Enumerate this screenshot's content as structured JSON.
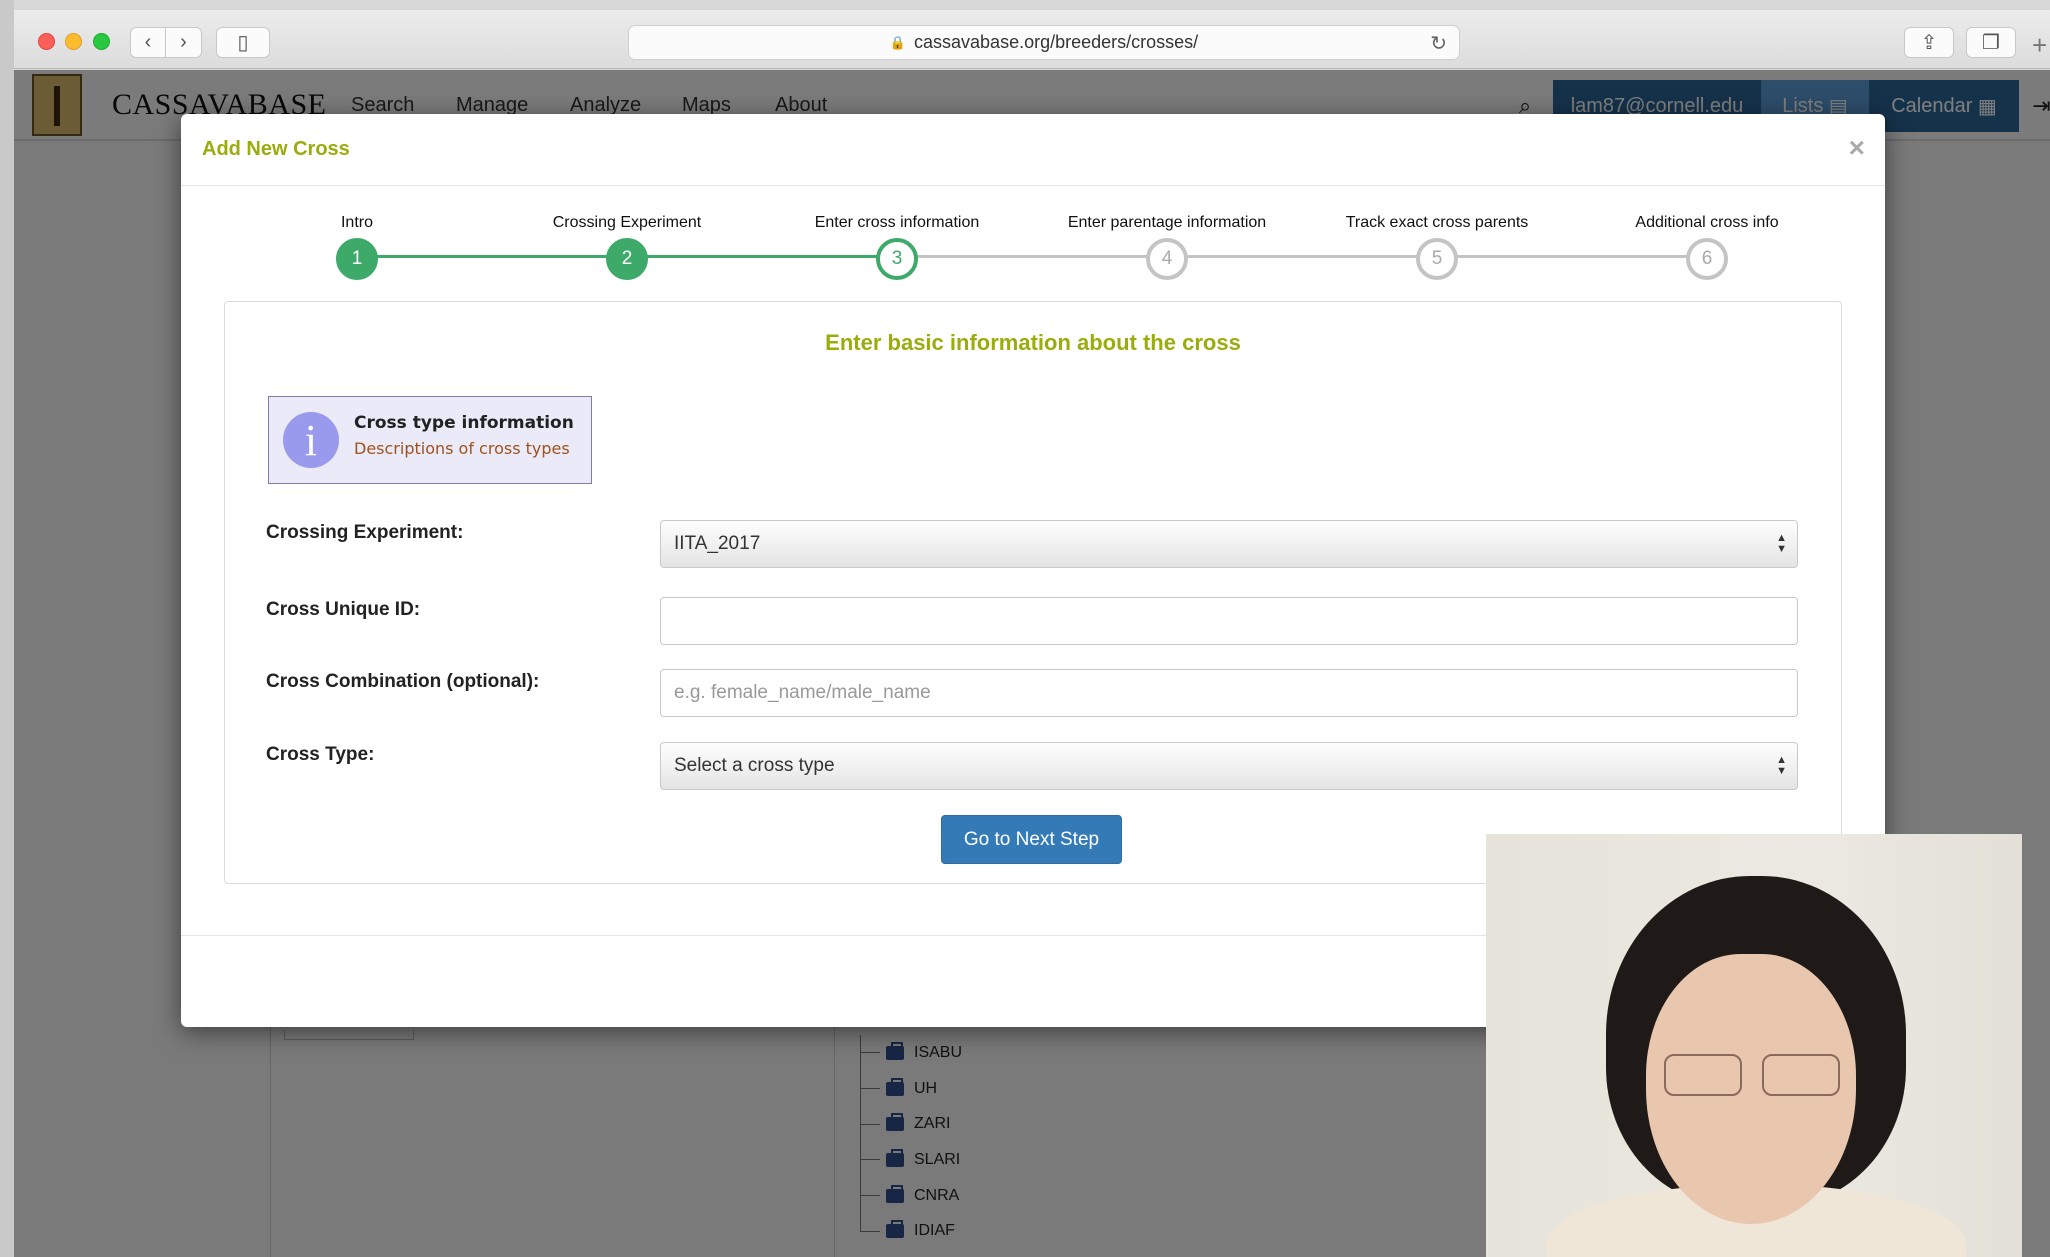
{
  "browser": {
    "url": "cassavabase.org/breeders/crosses/"
  },
  "site_nav": {
    "brand": "CASSAVABASE",
    "links": [
      "Search",
      "Manage",
      "Analyze",
      "Maps",
      "About"
    ],
    "user": "lam87@cornell.edu",
    "lists": "Lists",
    "calendar": "Calendar"
  },
  "background": {
    "tree_items": [
      "ISABU",
      "UH",
      "ZARI",
      "SLARI",
      "CNRA",
      "IDIAF"
    ]
  },
  "modal": {
    "title": "Add New Cross",
    "close": "×",
    "steps": [
      {
        "number": "1",
        "label": "Intro",
        "state": "done"
      },
      {
        "number": "2",
        "label": "Crossing Experiment",
        "state": "done"
      },
      {
        "number": "3",
        "label": "Enter cross information",
        "state": "current"
      },
      {
        "number": "4",
        "label": "Enter parentage information",
        "state": "todo"
      },
      {
        "number": "5",
        "label": "Track exact cross parents",
        "state": "todo"
      },
      {
        "number": "6",
        "label": "Additional cross info",
        "state": "todo"
      }
    ],
    "section_heading": "Enter basic information about the cross",
    "info_box": {
      "title": "Cross type information",
      "link": "Descriptions of cross types"
    },
    "form": {
      "crossing_experiment_label": "Crossing Experiment:",
      "crossing_experiment_value": "IITA_2017",
      "cross_unique_id_label": "Cross Unique ID:",
      "cross_unique_id_value": "",
      "cross_combination_label": "Cross Combination (optional):",
      "cross_combination_placeholder": "e.g. female_name/male_name",
      "cross_type_label": "Cross Type:",
      "cross_type_value": "Select a cross type"
    },
    "next_button": "Go to Next Step"
  },
  "colors": {
    "accent_title": "#9aad0c",
    "step_green": "#3daa6a",
    "primary_button": "#337ab7",
    "nav_user_bg": "#2a6496"
  }
}
